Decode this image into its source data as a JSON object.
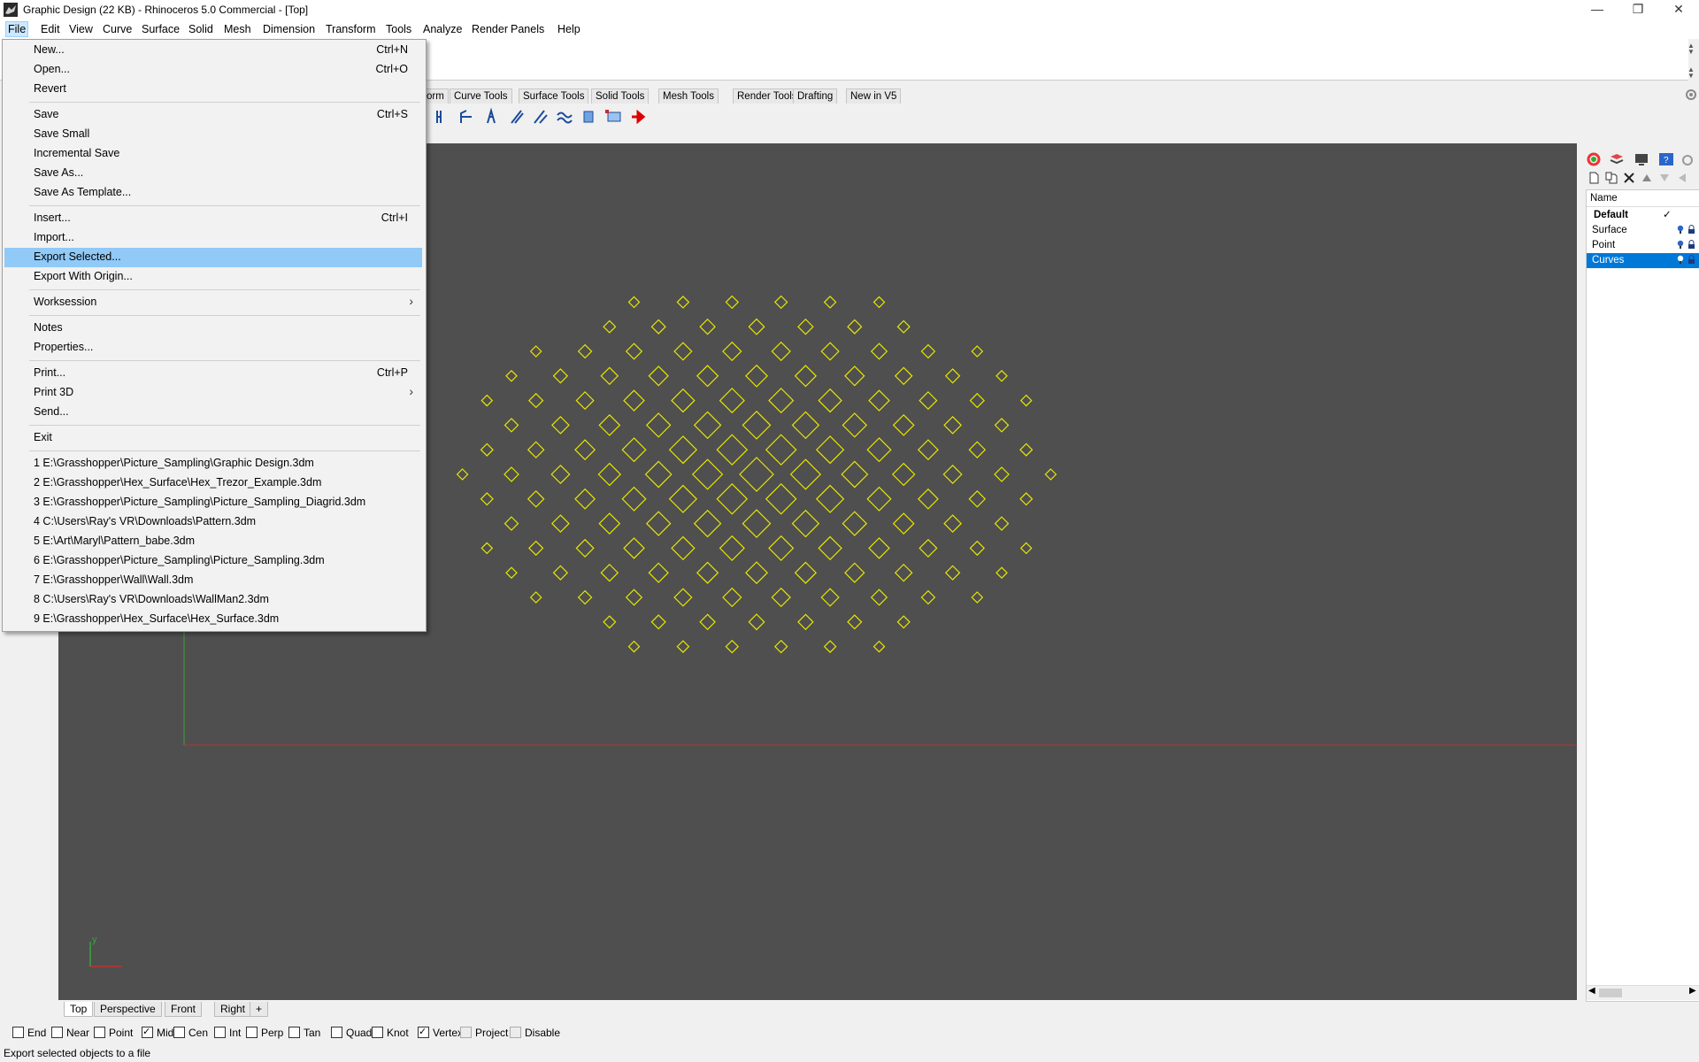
{
  "window": {
    "title": "Graphic Design (22 KB) - Rhinoceros 5.0 Commercial - [Top]",
    "controls": {
      "minimize": "—",
      "restore": "❐",
      "close": "✕"
    }
  },
  "menubar": {
    "items": [
      "File",
      "Edit",
      "View",
      "Curve",
      "Surface",
      "Solid",
      "Mesh",
      "Dimension",
      "Transform",
      "Tools",
      "Analyze",
      "Render",
      "Panels",
      "Help"
    ],
    "active": "File"
  },
  "toolbar_tabs": {
    "partial": "orm",
    "items": [
      "Curve Tools",
      "Surface Tools",
      "Solid Tools",
      "Mesh Tools",
      "Render Tools",
      "Drafting",
      "New in V5"
    ]
  },
  "file_menu": {
    "items": [
      {
        "label": "New...",
        "shortcut": "Ctrl+N"
      },
      {
        "label": "Open...",
        "shortcut": "Ctrl+O"
      },
      {
        "label": "Revert",
        "shortcut": ""
      },
      {
        "label": "Save",
        "shortcut": "Ctrl+S"
      },
      {
        "label": "Save Small",
        "shortcut": ""
      },
      {
        "label": "Incremental Save",
        "shortcut": ""
      },
      {
        "label": "Save As...",
        "shortcut": ""
      },
      {
        "label": "Save As Template...",
        "shortcut": ""
      },
      {
        "label": "Insert...",
        "shortcut": "Ctrl+I"
      },
      {
        "label": "Import...",
        "shortcut": ""
      },
      {
        "label": "Export Selected...",
        "shortcut": ""
      },
      {
        "label": "Export With Origin...",
        "shortcut": ""
      },
      {
        "label": "Worksession",
        "shortcut": ""
      },
      {
        "label": "Notes",
        "shortcut": ""
      },
      {
        "label": "Properties...",
        "shortcut": ""
      },
      {
        "label": "Print...",
        "shortcut": "Ctrl+P"
      },
      {
        "label": "Print 3D",
        "shortcut": ""
      },
      {
        "label": "Send...",
        "shortcut": ""
      },
      {
        "label": "Exit",
        "shortcut": ""
      },
      {
        "label": "1 E:\\Grasshopper\\Picture_Sampling\\Graphic Design.3dm",
        "shortcut": ""
      },
      {
        "label": "2 E:\\Grasshopper\\Hex_Surface\\Hex_Trezor_Example.3dm",
        "shortcut": ""
      },
      {
        "label": "3 E:\\Grasshopper\\Picture_Sampling\\Picture_Sampling_Diagrid.3dm",
        "shortcut": ""
      },
      {
        "label": "4 C:\\Users\\Ray's VR\\Downloads\\Pattern.3dm",
        "shortcut": ""
      },
      {
        "label": "5 E:\\Art\\Maryl\\Pattern_babe.3dm",
        "shortcut": ""
      },
      {
        "label": "6 E:\\Grasshopper\\Picture_Sampling\\Picture_Sampling.3dm",
        "shortcut": ""
      },
      {
        "label": "7 E:\\Grasshopper\\Wall\\Wall.3dm",
        "shortcut": ""
      },
      {
        "label": "8 C:\\Users\\Ray's VR\\Downloads\\WallMan2.3dm",
        "shortcut": ""
      },
      {
        "label": "9 E:\\Grasshopper\\Hex_Surface\\Hex_Surface.3dm",
        "shortcut": ""
      }
    ],
    "highlighted": "Export Selected...",
    "submenu_arrow": "›"
  },
  "viewport": {
    "name": "Top",
    "background": "#4f4f4f",
    "curve_color": "#e6e600",
    "axis_label_y": "y",
    "axis_label_x": "x"
  },
  "view_tabs": {
    "items": [
      "Top",
      "Perspective",
      "Front",
      "Right"
    ],
    "active": "Top",
    "add": "+"
  },
  "layers_panel": {
    "header": "Name",
    "rows": [
      {
        "name": "Default",
        "current": true,
        "selected": false
      },
      {
        "name": "Surface",
        "current": false,
        "selected": false
      },
      {
        "name": "Point",
        "current": false,
        "selected": false
      },
      {
        "name": "Curves",
        "current": false,
        "selected": true
      }
    ],
    "check_mark": "✓"
  },
  "osnaps": {
    "items": [
      {
        "label": "End",
        "checked": false
      },
      {
        "label": "Near",
        "checked": false
      },
      {
        "label": "Point",
        "checked": false
      },
      {
        "label": "Mid",
        "checked": true
      },
      {
        "label": "Cen",
        "checked": false
      },
      {
        "label": "Int",
        "checked": false
      },
      {
        "label": "Perp",
        "checked": false
      },
      {
        "label": "Tan",
        "checked": false
      },
      {
        "label": "Quad",
        "checked": false
      },
      {
        "label": "Knot",
        "checked": false
      },
      {
        "label": "Vertex",
        "checked": true
      },
      {
        "label": "Project",
        "checked": false
      },
      {
        "label": "Disable",
        "checked": false
      }
    ]
  },
  "status": {
    "text": "Export selected objects to a file"
  }
}
